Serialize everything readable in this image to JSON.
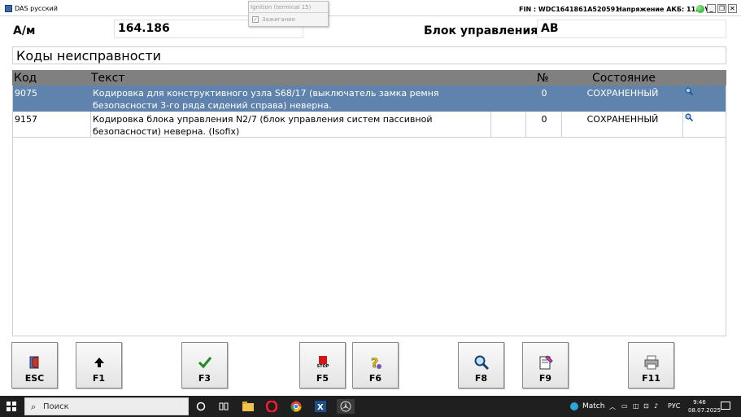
{
  "window": {
    "app_title": "DAS русский",
    "fin": "FIN : WDC1641861A520591",
    "voltage_label": "Напряжение АКБ: 11.9 V",
    "min_label": "_",
    "restore_label": "❐",
    "close_label": "✕"
  },
  "ignition_popup": {
    "title": "Ignition (terminal 15)",
    "checkbox_label": "Зажигание",
    "checked": true
  },
  "header": {
    "am_label": "А/м",
    "am_value": "164.186",
    "ecu_label": "Блок управления",
    "ecu_value": "AB"
  },
  "section_title": "Коды неисправности",
  "table": {
    "columns": {
      "code": "Код",
      "text": "Текст",
      "num": "№",
      "state": "Состояние"
    },
    "rows": [
      {
        "code": "9075",
        "text": "Кодировка для конструктивного узла S68/17 (выключатель замка ремня безопасности 3-го ряда сидений справа) неверна.",
        "num": "0",
        "state": "СОХРАНЕННЫЙ",
        "selected": true
      },
      {
        "code": "9157",
        "text": "Кодировка блока управления N2/7 (блок управления систем пассивной безопасности) неверна. (Isofix)",
        "num": "0",
        "state": "СОХРАНЕННЫЙ",
        "selected": false
      }
    ]
  },
  "fkeys": {
    "esc": "ESC",
    "f1": "F1",
    "f3": "F3",
    "f5": "F5",
    "f5_stop": "STOP",
    "f6": "F6",
    "f8": "F8",
    "f9": "F9",
    "f11": "F11"
  },
  "taskbar": {
    "search_placeholder": "Поиск",
    "weather": "Match",
    "lang": "РУС",
    "time": "9:46",
    "date": "08.07.2025"
  },
  "colors": {
    "selected_row": "#5f83ac",
    "table_header": "#808080",
    "taskbar": "#1f1f1f",
    "status_ok": "#1a9a1a"
  }
}
